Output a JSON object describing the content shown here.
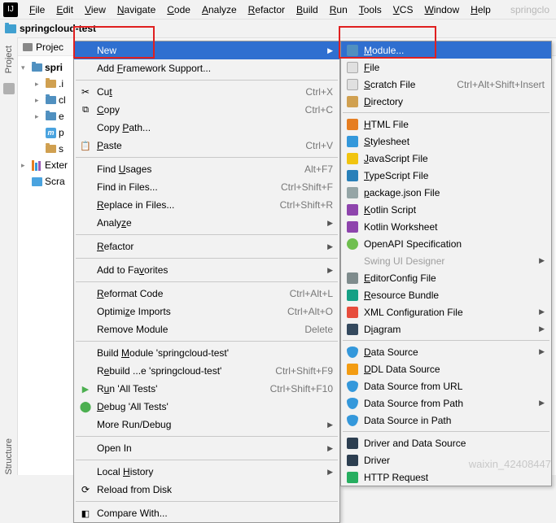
{
  "menubar": {
    "items": [
      "File",
      "Edit",
      "View",
      "Navigate",
      "Code",
      "Analyze",
      "Refactor",
      "Build",
      "Run",
      "Tools",
      "VCS",
      "Window",
      "Help"
    ],
    "trailing": "springclo"
  },
  "breadcrumb": {
    "project": "springcloud-test"
  },
  "project": {
    "header": "Projec",
    "root": "spri",
    "children": [
      ".i",
      "cl",
      "e",
      "p",
      "s"
    ],
    "external": "Exter",
    "scratches": "Scra"
  },
  "ctx1": [
    {
      "label": "New",
      "hl": true,
      "arrow": true
    },
    {
      "label": "Add Framework Support...",
      "u": "F"
    },
    {
      "sep": true
    },
    {
      "label": "Cut",
      "u": "t",
      "icon": "cut",
      "shortcut": "Ctrl+X"
    },
    {
      "label": "Copy",
      "u": "C",
      "icon": "copy",
      "shortcut": "Ctrl+C"
    },
    {
      "label": "Copy Path...",
      "u": "P"
    },
    {
      "label": "Paste",
      "u": "P",
      "icon": "paste",
      "shortcut": "Ctrl+V"
    },
    {
      "sep": true
    },
    {
      "label": "Find Usages",
      "u": "U",
      "shortcut": "Alt+F7"
    },
    {
      "label": "Find in Files...",
      "shortcut": "Ctrl+Shift+F"
    },
    {
      "label": "Replace in Files...",
      "u": "R",
      "shortcut": "Ctrl+Shift+R"
    },
    {
      "label": "Analyze",
      "u": "z",
      "arrow": true
    },
    {
      "sep": true
    },
    {
      "label": "Refactor",
      "u": "R",
      "arrow": true
    },
    {
      "sep": true
    },
    {
      "label": "Add to Favorites",
      "u": "v",
      "arrow": true
    },
    {
      "sep": true
    },
    {
      "label": "Reformat Code",
      "u": "R",
      "shortcut": "Ctrl+Alt+L"
    },
    {
      "label": "Optimize Imports",
      "u": "z",
      "shortcut": "Ctrl+Alt+O"
    },
    {
      "label": "Remove Module",
      "shortcut": "Delete"
    },
    {
      "sep": true
    },
    {
      "label": "Build Module 'springcloud-test'",
      "u": "M"
    },
    {
      "label": "Rebuild ...e 'springcloud-test'",
      "u": "e",
      "shortcut": "Ctrl+Shift+F9"
    },
    {
      "label": "Run 'All Tests'",
      "u": "u",
      "icon": "play",
      "shortcut": "Ctrl+Shift+F10"
    },
    {
      "label": "Debug 'All Tests'",
      "u": "D",
      "icon": "bug"
    },
    {
      "label": "More Run/Debug",
      "arrow": true
    },
    {
      "sep": true
    },
    {
      "label": "Open In",
      "arrow": true
    },
    {
      "sep": true
    },
    {
      "label": "Local History",
      "u": "H",
      "arrow": true
    },
    {
      "label": "Reload from Disk",
      "icon": "reload"
    },
    {
      "sep": true
    },
    {
      "label": "Compare With...",
      "icon": "compare"
    }
  ],
  "ctx2": [
    {
      "label": "Module...",
      "u": "M",
      "icon": "fi-module",
      "hl": true
    },
    {
      "label": "File",
      "u": "F",
      "icon": "fi-file"
    },
    {
      "label": "Scratch File",
      "u": "S",
      "icon": "fi-scratch",
      "shortcut": "Ctrl+Alt+Shift+Insert"
    },
    {
      "label": "Directory",
      "u": "D",
      "icon": "fi-dir"
    },
    {
      "sep": true
    },
    {
      "label": "HTML File",
      "u": "H",
      "icon": "fi-html"
    },
    {
      "label": "Stylesheet",
      "u": "S",
      "icon": "fi-css"
    },
    {
      "label": "JavaScript File",
      "u": "J",
      "icon": "fi-js"
    },
    {
      "label": "TypeScript File",
      "u": "T",
      "icon": "fi-ts"
    },
    {
      "label": "package.json File",
      "u": "p",
      "icon": "fi-json"
    },
    {
      "label": "Kotlin Script",
      "u": "K",
      "icon": "fi-kt"
    },
    {
      "label": "Kotlin Worksheet",
      "icon": "fi-ktw"
    },
    {
      "label": "OpenAPI Specification",
      "icon": "fi-oapi"
    },
    {
      "label": "Swing UI Designer",
      "disabled": true,
      "arrow": true
    },
    {
      "label": "EditorConfig File",
      "u": "E",
      "icon": "fi-ec"
    },
    {
      "label": "Resource Bundle",
      "u": "R",
      "icon": "fi-rb"
    },
    {
      "label": "XML Configuration File",
      "arrow": true,
      "icon": "fi-xml"
    },
    {
      "label": "Diagram",
      "u": "i",
      "arrow": true,
      "icon": "fi-diag"
    },
    {
      "sep": true
    },
    {
      "label": "Data Source",
      "u": "D",
      "arrow": true,
      "icon": "fi-ds"
    },
    {
      "label": "DDL Data Source",
      "u": "D",
      "icon": "fi-ddl"
    },
    {
      "label": "Data Source from URL",
      "icon": "fi-ds"
    },
    {
      "label": "Data Source from Path",
      "arrow": true,
      "icon": "fi-ds"
    },
    {
      "label": "Data Source in Path",
      "icon": "fi-ds"
    },
    {
      "sep": true
    },
    {
      "label": "Driver and Data Source",
      "icon": "fi-drv"
    },
    {
      "label": "Driver",
      "icon": "fi-drv"
    },
    {
      "label": "HTTP Request",
      "icon": "fi-http"
    }
  ],
  "watermark": "waixin_42408447"
}
